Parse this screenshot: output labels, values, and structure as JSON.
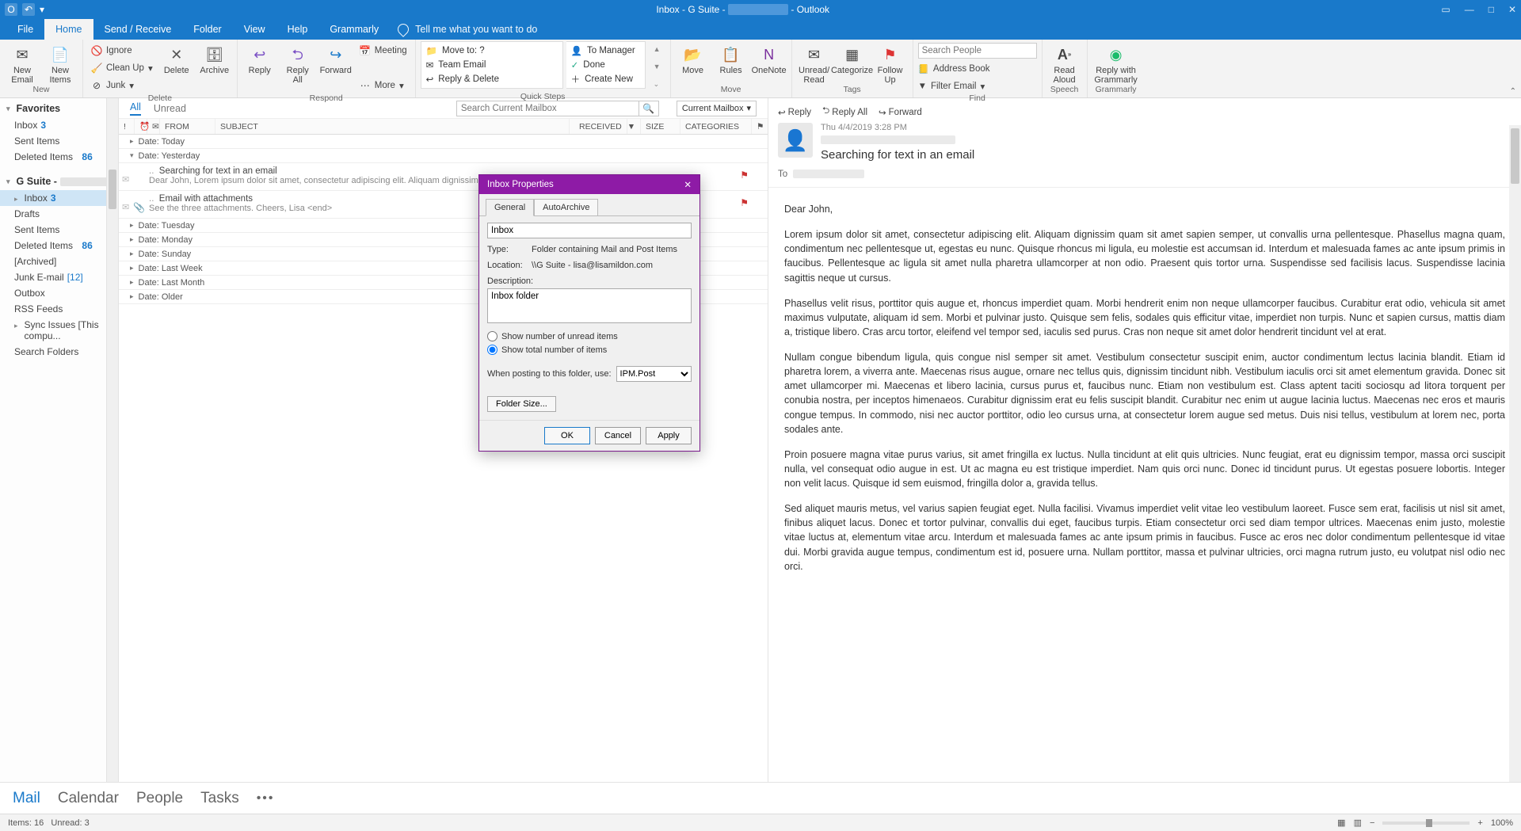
{
  "titlebar": {
    "title_left": "Inbox - G Suite -",
    "title_right": "- Outlook"
  },
  "tabs": {
    "file": "File",
    "home": "Home",
    "sendrecv": "Send / Receive",
    "folder": "Folder",
    "view": "View",
    "help": "Help",
    "grammarly": "Grammarly",
    "tellme": "Tell me what you want to do"
  },
  "ribbon": {
    "new_email": "New\nEmail",
    "new_items": "New\nItems",
    "new_group": "New",
    "ignore": "Ignore",
    "cleanup": "Clean Up",
    "junk": "Junk",
    "delete": "Delete",
    "archive": "Archive",
    "delete_group": "Delete",
    "reply": "Reply",
    "replyall": "Reply\nAll",
    "forward": "Forward",
    "meeting": "Meeting",
    "more": "More",
    "respond_group": "Respond",
    "moveto": "Move to: ?",
    "teamemail": "Team Email",
    "replydel": "Reply & Delete",
    "tomgr": "To Manager",
    "done": "Done",
    "createnew": "Create New",
    "qs_group": "Quick Steps",
    "move": "Move",
    "rules": "Rules",
    "onenote": "OneNote",
    "move_group": "Move",
    "unread": "Unread/\nRead",
    "categorize": "Categorize",
    "followup": "Follow\nUp",
    "tags_group": "Tags",
    "search_ph": "Search People",
    "addrbook": "Address Book",
    "filteremail": "Filter Email",
    "find_group": "Find",
    "readaloud": "Read\nAloud",
    "speech_group": "Speech",
    "replygram": "Reply with\nGrammarly",
    "gram_group": "Grammarly"
  },
  "nav": {
    "favorites": "Favorites",
    "inbox": "Inbox",
    "inbox_cnt": "3",
    "sent": "Sent Items",
    "deleted": "Deleted Items",
    "deleted_cnt": "86",
    "account": "G Suite -",
    "drafts": "Drafts",
    "archived": "[Archived]",
    "junk": "Junk E-mail",
    "junk_cnt": "[12]",
    "outbox": "Outbox",
    "rss": "RSS Feeds",
    "sync": "Sync Issues [This compu...",
    "searchf": "Search Folders"
  },
  "list": {
    "all": "All",
    "unread": "Unread",
    "search_ph": "Search Current Mailbox",
    "scope": "Current Mailbox",
    "col_from": "FROM",
    "col_subject": "SUBJECT",
    "col_received": "RECEIVED",
    "col_size": "SIZE",
    "col_cat": "CATEGORIES",
    "g_today": "Date: Today",
    "g_yesterday": "Date: Yesterday",
    "g_tuesday": "Date: Tuesday",
    "g_monday": "Date: Monday",
    "g_sunday": "Date: Sunday",
    "g_lastweek": "Date: Last Week",
    "g_lastmonth": "Date: Last Month",
    "g_older": "Date: Older",
    "m1_subj": "Searching for text in an email",
    "m1_prev": "Dear John,  Lorem ipsum dolor sit amet, consectetur adipiscing elit. Aliquam dignissim quam sit am",
    "m2_subj": "Email with attachments",
    "m2_prev": "See the three attachments.  Cheers,  Lisa <end>"
  },
  "read": {
    "reply": "Reply",
    "replyall": "Reply All",
    "forward": "Forward",
    "date": "Thu 4/4/2019 3:28 PM",
    "subject": "Searching for text in an email",
    "to_label": "To",
    "p0": "Dear John,",
    "p1": "Lorem ipsum dolor sit amet, consectetur adipiscing elit. Aliquam dignissim quam sit amet sapien semper, ut convallis urna pellentesque. Phasellus magna quam, condimentum nec pellentesque ut, egestas eu nunc. Quisque rhoncus mi ligula, eu molestie est accumsan id. Interdum et malesuada fames ac ante ipsum primis in faucibus. Pellentesque ac ligula sit amet nulla pharetra ullamcorper at non odio. Praesent quis tortor urna. Suspendisse sed facilisis lacus. Suspendisse lacinia sagittis neque ut cursus.",
    "p2": "Phasellus velit risus, porttitor quis augue et, rhoncus imperdiet quam. Morbi hendrerit enim non neque ullamcorper faucibus. Curabitur erat odio, vehicula sit amet maximus vulputate, aliquam id sem. Morbi et pulvinar justo. Quisque sem felis, sodales quis efficitur vitae, imperdiet non turpis. Nunc et sapien cursus, mattis diam a, tristique libero. Cras arcu tortor, eleifend vel tempor sed, iaculis sed purus. Cras non neque sit amet dolor hendrerit tincidunt vel at erat.",
    "p3": "Nullam congue bibendum ligula, quis congue nisl semper sit amet. Vestibulum consectetur suscipit enim, auctor condimentum lectus lacinia blandit. Etiam id pharetra lorem, a viverra ante. Maecenas risus augue, ornare nec tellus quis, dignissim tincidunt nibh. Vestibulum iaculis orci sit amet elementum gravida. Donec sit amet ullamcorper mi. Maecenas et libero lacinia, cursus purus et, faucibus nunc. Etiam non vestibulum est. Class aptent taciti sociosqu ad litora torquent per conubia nostra, per inceptos himenaeos. Curabitur dignissim erat eu felis suscipit blandit. Curabitur nec enim ut augue lacinia luctus. Maecenas nec eros et mauris congue tempus. In commodo, nisi nec auctor porttitor, odio leo cursus urna, at consectetur lorem augue sed metus. Duis nisi tellus, vestibulum at lorem nec, porta sodales ante.",
    "p4": "Proin posuere magna vitae purus varius, sit amet fringilla ex luctus. Nulla tincidunt at elit quis ultricies. Nunc feugiat, erat eu dignissim tempor, massa orci suscipit nulla, vel consequat odio augue in est. Ut ac magna eu est tristique imperdiet. Nam quis orci nunc. Donec id tincidunt purus. Ut egestas posuere lobortis. Integer non velit lacus. Quisque id sem euismod, fringilla dolor a, gravida tellus.",
    "p5": "Sed aliquet mauris metus, vel varius sapien feugiat eget. Nulla facilisi. Vivamus imperdiet velit vitae leo vestibulum laoreet. Fusce sem erat, facilisis ut nisl sit amet, finibus aliquet lacus. Donec et tortor pulvinar, convallis dui eget, faucibus turpis. Etiam consectetur orci sed diam tempor ultrices. Maecenas enim justo, molestie vitae luctus at, elementum vitae arcu. Interdum et malesuada fames ac ante ipsum primis in faucibus. Fusce ac eros nec dolor condimentum pellentesque id vitae dui. Morbi gravida augue tempus, condimentum est id, posuere urna. Nullam porttitor, massa et pulvinar ultricies, orci magna rutrum justo, eu volutpat nisl odio nec orci."
  },
  "navbar": {
    "mail": "Mail",
    "calendar": "Calendar",
    "people": "People",
    "tasks": "Tasks"
  },
  "status": {
    "items": "Items: 16",
    "unread": "Unread: 3",
    "zoom": "100%"
  },
  "dialog": {
    "title": "Inbox Properties",
    "tab_general": "General",
    "tab_auto": "AutoArchive",
    "name_val": "Inbox",
    "type_l": "Type:",
    "type_v": "Folder containing Mail and Post Items",
    "loc_l": "Location:",
    "loc_v": "\\\\G Suite - lisa@lisamildon.com",
    "desc_l": "Description:",
    "desc_v": "Inbox folder",
    "r_unread": "Show number of unread items",
    "r_total": "Show total number of items",
    "post_l": "When posting to this folder, use:",
    "post_v": "IPM.Post",
    "fsize": "Folder Size...",
    "ok": "OK",
    "cancel": "Cancel",
    "apply": "Apply"
  }
}
